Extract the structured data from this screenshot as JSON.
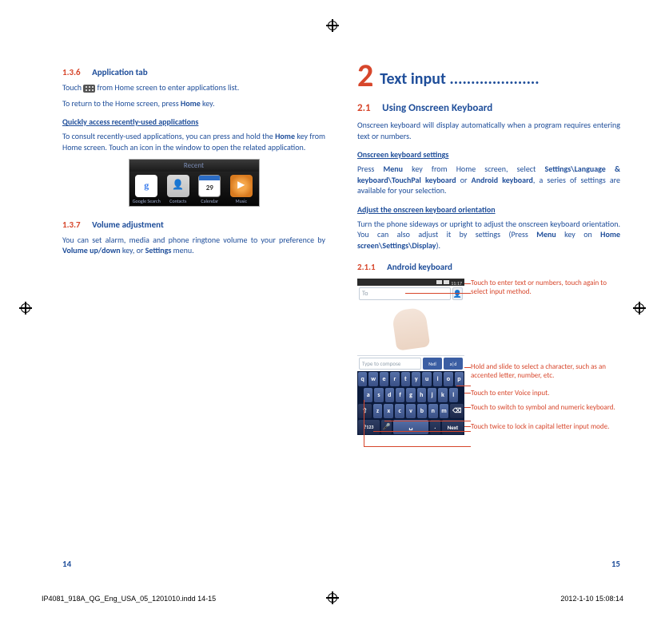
{
  "left": {
    "h136": {
      "num": "1.3.6",
      "title": "Application tab"
    },
    "p1a": "Touch ",
    "p1b": " from Home screen to enter applications list.",
    "p2a": "To return to the Home screen, press ",
    "p2_home": "Home",
    "p2b": " key.",
    "sub_recent": "Quickly access recently-used applications",
    "p3a": "To consult recently-used applications, you can press and hold the ",
    "p3_home": "Home",
    "p3b": " key from Home screen. Touch an icon in the window to open the related application.",
    "recent": {
      "header": "Recent",
      "items": [
        "Google Search",
        "Contacts",
        "Calendar",
        "Music"
      ],
      "cal_day": "29",
      "g": "g"
    },
    "h137": {
      "num": "1.3.7",
      "title": "Volume adjustment"
    },
    "p4a": "You can set alarm, media and phone ringtone volume to your preference by ",
    "p4_vol": "Volume up/down",
    "p4b": " key, or ",
    "p4_set": "Settings",
    "p4c": " menu."
  },
  "right": {
    "chapter_num": "2",
    "chapter_title": "Text input .....................",
    "s21": {
      "num": "2.1",
      "title": "Using Onscreen Keyboard"
    },
    "p1": "Onscreen keyboard will display automatically when a program requires entering text or numbers.",
    "sub_settings": "Onscreen keyboard settings",
    "p2a": "Press ",
    "p2_menu": "Menu",
    "p2b": " key from Home screen, select ",
    "p2_path": "Settings\\Language & keyboard\\TouchPal keyboard",
    "p2c": " or ",
    "p2_andro": "Android keyboard",
    "p2d": ", a series of settings are available for your selection.",
    "sub_orient": "Adjust the onscreen keyboard orientation",
    "p3a": "Turn the phone sideways or upright to adjust the onscreen keyboard orientation. You can also adjust it by settings (Press ",
    "p3_menu": "Menu",
    "p3b": " key on ",
    "p3_path": "Home screen\\Settings\\Display",
    "p3c": ").",
    "s211": {
      "num": "2.1.1",
      "title": "Android keyboard"
    },
    "kbd": {
      "time": "11:17",
      "to": "To",
      "compose": "Type to compose",
      "tag1": "Nstl",
      "tag2": "a|d",
      "row1": [
        "q",
        "w",
        "e",
        "r",
        "t",
        "y",
        "u",
        "i",
        "o",
        "p"
      ],
      "row2": [
        "a",
        "s",
        "d",
        "f",
        "g",
        "h",
        "j",
        "k",
        "l"
      ],
      "row3": [
        "⇧",
        "z",
        "x",
        "c",
        "v",
        "b",
        "n",
        "m",
        "⌫"
      ],
      "row4": [
        "?123",
        "🎤",
        "␣",
        ".",
        "Next"
      ]
    },
    "callouts": {
      "c1": "Touch to enter text or numbers, touch again to select input method.",
      "c2": "Hold and slide to select a character, such as an accented letter, number, etc.",
      "c3": "Touch to enter Voice input.",
      "c4": "Touch to switch to symbol and numeric keyboard.",
      "c5": "Touch twice to lock in capital letter input mode."
    }
  },
  "page_left": "14",
  "page_right": "15",
  "footer_left": "IP4081_918A_QG_Eng_USA_05_1201010.indd   14-15",
  "footer_right": "2012-1-10   15:08:14"
}
